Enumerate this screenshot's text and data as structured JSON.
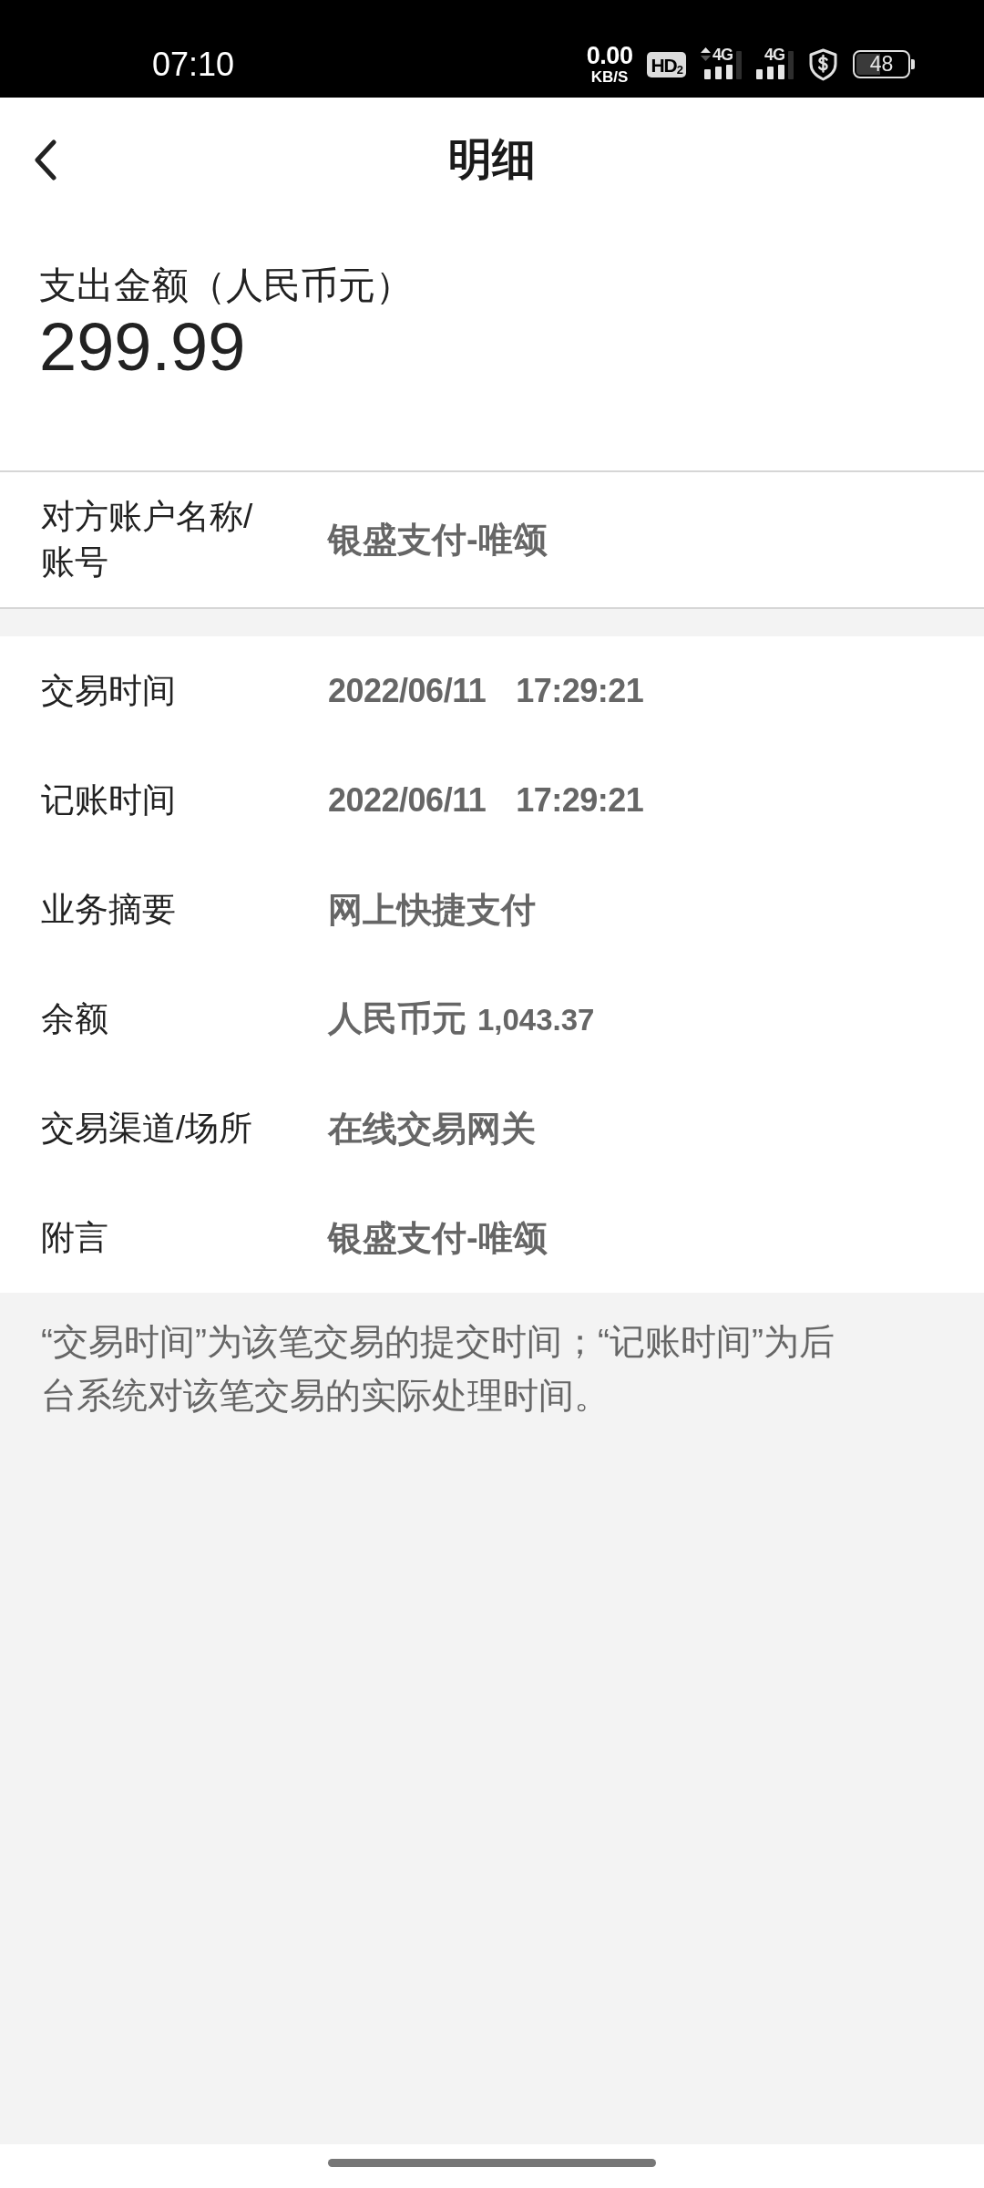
{
  "status_bar": {
    "time": "07:10",
    "net_speed": {
      "value": "0.00",
      "unit": "KB/S"
    },
    "hd_badge": "HD$_{2}$",
    "signals": [
      {
        "network": "4G",
        "data_arrows": true
      },
      {
        "network": "4G",
        "data_arrows": false
      }
    ],
    "battery": "48"
  },
  "header": {
    "title": "明细"
  },
  "amount": {
    "label": "支出金额（人民币元）",
    "value": "299.99"
  },
  "counterparty": {
    "label": "对方账户名称/账号",
    "value": "银盛支付-唯颂"
  },
  "details": [
    {
      "kind": "datetime",
      "label": "交易时间",
      "date": "2022/06/11",
      "time": "17:29:21"
    },
    {
      "kind": "datetime",
      "label": "记账时间",
      "date": "2022/06/11",
      "time": "17:29:21"
    },
    {
      "kind": "text",
      "label": "业务摘要",
      "value": "网上快捷支付"
    },
    {
      "kind": "money",
      "label": "余额",
      "currency": "人民币元",
      "amount": "1,043.37"
    },
    {
      "kind": "text",
      "label": "交易渠道/场所",
      "value": "在线交易网关"
    },
    {
      "kind": "text",
      "label": "附言",
      "value": "银盛支付-唯颂"
    }
  ],
  "note": "“交易时间”为该笔交易的提交时间；“记账时间”为后台系统对该笔交易的实际处理时间。"
}
